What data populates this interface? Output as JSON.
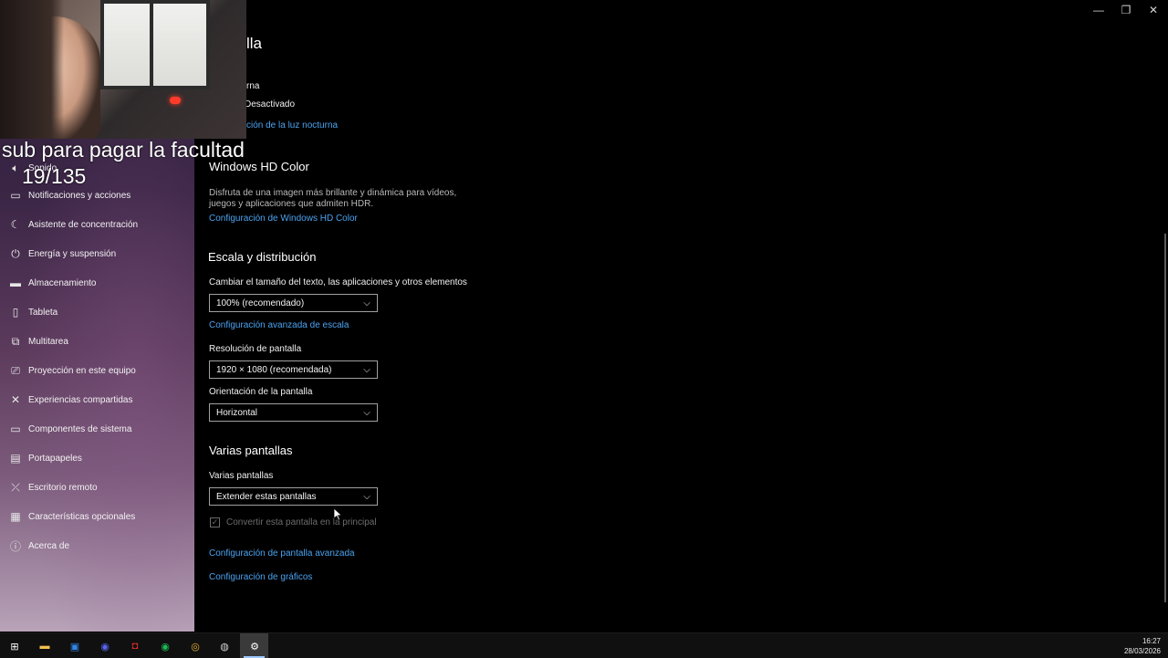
{
  "window": {
    "title_partial": "lla",
    "controls": {
      "minimize": "—",
      "restore": "❐",
      "close": "✕"
    }
  },
  "night_light": {
    "label_partial": "rna",
    "status": "Desactivado",
    "link_partial": "ción de la luz nocturna"
  },
  "overlay": {
    "caption": "sub para pagar la facultad",
    "counter": "19/135"
  },
  "sidebar": {
    "partial_item": "Sonido",
    "items": [
      {
        "icon": "notifications-icon",
        "glyph": "▭",
        "label": "Notificaciones y acciones"
      },
      {
        "icon": "focus-assist-icon",
        "glyph": "☾",
        "label": "Asistente de concentración"
      },
      {
        "icon": "power-icon",
        "glyph": "⏻",
        "label": "Energía y suspensión"
      },
      {
        "icon": "storage-icon",
        "glyph": "▬",
        "label": "Almacenamiento"
      },
      {
        "icon": "tablet-icon",
        "glyph": "▯",
        "label": "Tableta"
      },
      {
        "icon": "multitasking-icon",
        "glyph": "⧉",
        "label": "Multitarea"
      },
      {
        "icon": "projection-icon",
        "glyph": "⎚",
        "label": "Proyección en este equipo"
      },
      {
        "icon": "shared-experiences-icon",
        "glyph": "✕",
        "label": "Experiencias compartidas"
      },
      {
        "icon": "system-components-icon",
        "glyph": "▭",
        "label": "Componentes de sistema"
      },
      {
        "icon": "clipboard-icon",
        "glyph": "▤",
        "label": "Portapapeles"
      },
      {
        "icon": "remote-desktop-icon",
        "glyph": "⤫",
        "label": "Escritorio remoto"
      },
      {
        "icon": "optional-features-icon",
        "glyph": "▦",
        "label": "Características opcionales"
      },
      {
        "icon": "about-icon",
        "glyph": "ⓘ",
        "label": "Acerca de"
      }
    ]
  },
  "hdr": {
    "heading": "Windows HD Color",
    "description": "Disfruta de una imagen más brillante y dinámica para vídeos, juegos y aplicaciones que admiten HDR.",
    "link": "Configuración de Windows HD Color"
  },
  "scale": {
    "heading": "Escala y distribución",
    "size_label": "Cambiar el tamaño del texto, las aplicaciones y otros elementos",
    "size_value": "100% (recomendado)",
    "advanced_link": "Configuración avanzada de escala",
    "resolution_label": "Resolución de pantalla",
    "resolution_value": "1920 × 1080 (recomendada)",
    "orientation_label": "Orientación de la pantalla",
    "orientation_value": "Horizontal"
  },
  "multiple": {
    "heading": "Varias pantallas",
    "label": "Varias pantallas",
    "value": "Extender estas pantallas",
    "checkbox_label": "Convertir esta pantalla en la principal",
    "checkbox_checked": true,
    "advanced_link": "Configuración de pantalla avanzada",
    "graphics_link": "Configuración de gráficos"
  },
  "taskbar": {
    "icons": [
      {
        "name": "start-icon",
        "glyph": "⊞",
        "color": "#ffffff"
      },
      {
        "name": "file-explorer-icon",
        "glyph": "▬",
        "color": "#f2c14e"
      },
      {
        "name": "store-icon",
        "glyph": "▣",
        "color": "#2f86e8"
      },
      {
        "name": "discord-icon",
        "glyph": "◉",
        "color": "#5865f2"
      },
      {
        "name": "app-red-icon",
        "glyph": "◘",
        "color": "#e02d2d"
      },
      {
        "name": "spotify-icon",
        "glyph": "◉",
        "color": "#1db954"
      },
      {
        "name": "chrome-icon",
        "glyph": "◎",
        "color": "#e9b232"
      },
      {
        "name": "obs-icon",
        "glyph": "◍",
        "color": "#d0d0d0"
      },
      {
        "name": "settings-icon",
        "glyph": "⚙",
        "color": "#ffffff"
      }
    ],
    "time": "16:27",
    "date": "28/03/2026"
  }
}
